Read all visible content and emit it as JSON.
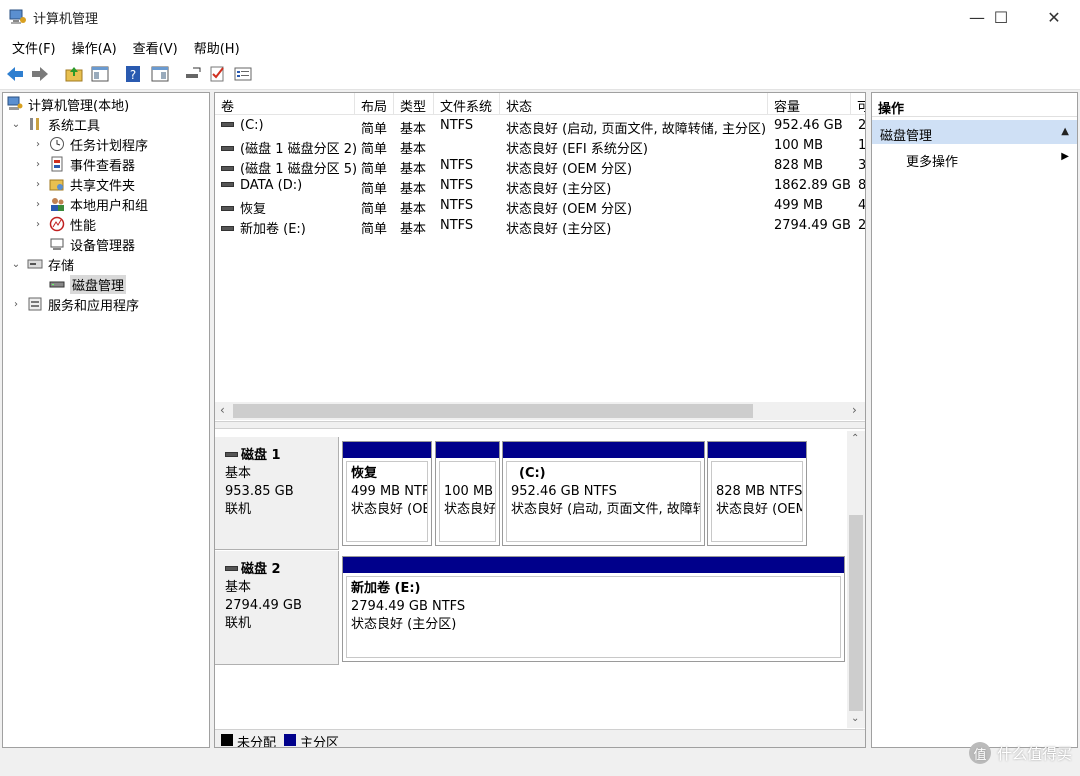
{
  "window": {
    "title": "计算机管理",
    "minimize_glyph": "—",
    "maximize_glyph": "☐",
    "close_glyph": "✕"
  },
  "menu": [
    "文件(F)",
    "操作(A)",
    "查看(V)",
    "帮助(H)"
  ],
  "toolbar_icons": [
    "back-arrow-icon",
    "forward-arrow-icon",
    "up-folder-icon",
    "show-hide-tree-icon",
    "help-icon",
    "properties-icon",
    "connect-icon",
    "check-icon",
    "settings-list-icon"
  ],
  "tree": {
    "root": "计算机管理(本地)",
    "system_tools": "系统工具",
    "task_scheduler": "任务计划程序",
    "event_viewer": "事件查看器",
    "shared_folders": "共享文件夹",
    "local_users": "本地用户和组",
    "performance": "性能",
    "device_manager": "设备管理器",
    "storage": "存储",
    "disk_management": "磁盘管理",
    "services_apps": "服务和应用程序"
  },
  "table": {
    "columns": [
      "卷",
      "布局",
      "类型",
      "文件系统",
      "状态",
      "容量",
      "可"
    ],
    "rows": [
      {
        "volume": "(C:)",
        "layout": "简单",
        "type": "基本",
        "fs": "NTFS",
        "status": "状态良好 (启动, 页面文件, 故障转储, 主分区)",
        "capacity": "952.46 GB",
        "free": "2"
      },
      {
        "volume": "(磁盘 1 磁盘分区 2)",
        "layout": "简单",
        "type": "基本",
        "fs": "",
        "status": "状态良好 (EFI 系统分区)",
        "capacity": "100 MB",
        "free": "1"
      },
      {
        "volume": "(磁盘 1 磁盘分区 5)",
        "layout": "简单",
        "type": "基本",
        "fs": "NTFS",
        "status": "状态良好 (OEM 分区)",
        "capacity": "828 MB",
        "free": "3"
      },
      {
        "volume": "DATA (D:)",
        "layout": "简单",
        "type": "基本",
        "fs": "NTFS",
        "status": "状态良好 (主分区)",
        "capacity": "1862.89 GB",
        "free": "8"
      },
      {
        "volume": "恢复",
        "layout": "简单",
        "type": "基本",
        "fs": "NTFS",
        "status": "状态良好 (OEM 分区)",
        "capacity": "499 MB",
        "free": "4"
      },
      {
        "volume": "新加卷 (E:)",
        "layout": "简单",
        "type": "基本",
        "fs": "NTFS",
        "status": "状态良好 (主分区)",
        "capacity": "2794.49 GB",
        "free": "2"
      }
    ]
  },
  "disks": {
    "disk1": {
      "name": "磁盘 1",
      "type": "基本",
      "size": "953.85 GB",
      "state": "联机",
      "partitions": [
        {
          "name": "恢复",
          "size": "499 MB NTF",
          "status": "状态良好 (OE"
        },
        {
          "name": "",
          "size": "100 MB",
          "status": "状态良好"
        },
        {
          "name": "(C:)",
          "size": "952.46 GB NTFS",
          "status": "状态良好 (启动, 页面文件, 故障转"
        },
        {
          "name": "",
          "size": "828 MB NTFS",
          "status": "状态良好 (OEM"
        }
      ]
    },
    "disk2": {
      "name": "磁盘 2",
      "type": "基本",
      "size": "2794.49 GB",
      "state": "联机",
      "partitions": [
        {
          "name": "新加卷 (E:)",
          "size": "2794.49 GB NTFS",
          "status": "状态良好 (主分区)"
        }
      ]
    }
  },
  "legend": {
    "unallocated": "未分配",
    "primary": "主分区",
    "unallocated_color": "#000000",
    "primary_color": "#00008b"
  },
  "actions": {
    "header": "操作",
    "section": "磁盘管理",
    "more": "更多操作"
  },
  "watermark": {
    "badge": "值",
    "text": "什么值得买"
  }
}
